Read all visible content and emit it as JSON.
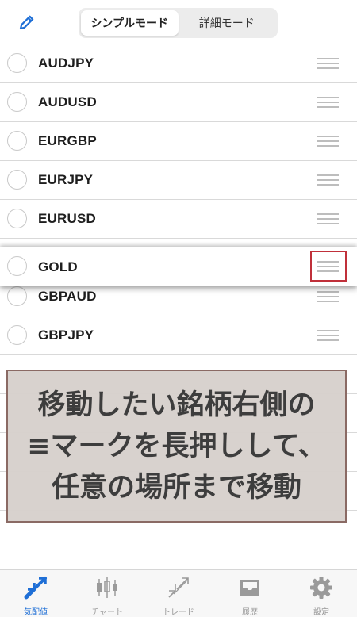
{
  "header": {
    "segments": [
      {
        "label": "シンプルモード",
        "active": true
      },
      {
        "label": "詳細モード",
        "active": false
      }
    ]
  },
  "list": {
    "items": [
      {
        "symbol": "AUDJPY"
      },
      {
        "symbol": "AUDUSD"
      },
      {
        "symbol": "EURGBP"
      },
      {
        "symbol": "EURJPY"
      },
      {
        "symbol": "EURUSD"
      },
      {
        "symbol": "GOLD",
        "dragging": true
      },
      {
        "symbol": "GBPAUD"
      },
      {
        "symbol": "GBPJPY"
      }
    ]
  },
  "annotation": {
    "lines": [
      "移動したい銘柄右側の",
      "≡マークを長押しして、",
      "任意の場所まで移動"
    ]
  },
  "tabbar": {
    "tabs": [
      {
        "label": "気配値",
        "icon": "quotes-arrows-icon",
        "active": true
      },
      {
        "label": "チャート",
        "icon": "candlestick-icon",
        "active": false
      },
      {
        "label": "トレード",
        "icon": "trade-icon",
        "active": false
      },
      {
        "label": "履歴",
        "icon": "history-tray-icon",
        "active": false
      },
      {
        "label": "設定",
        "icon": "gear-icon",
        "active": false
      }
    ]
  },
  "colors": {
    "accent": "#1f6fd6",
    "highlight_border": "#c0303a",
    "annotation_bg": "#d6d0cc",
    "annotation_text": "#3d3d3d"
  }
}
